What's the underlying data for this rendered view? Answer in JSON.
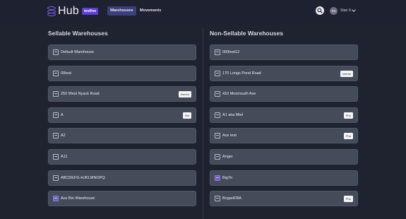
{
  "app": {
    "title": "Hub",
    "badge": "testlive"
  },
  "nav": [
    {
      "label": "Warehouses",
      "active": true
    },
    {
      "label": "Movements",
      "active": false
    }
  ],
  "user": {
    "initials": "SS",
    "name": "Stan S"
  },
  "sellable": {
    "title": "Sellable Warehouses",
    "items": [
      {
        "label": "Default Warehouse",
        "tag": "",
        "icon": "warehouse-icon"
      },
      {
        "label": "00test",
        "tag": "",
        "icon": "warehouse-icon"
      },
      {
        "label": "250 West Nyack Road",
        "tag": "Interim",
        "icon": "warehouse-icon"
      },
      {
        "label": "A",
        "tag": "Bin",
        "icon": "warehouse-icon"
      },
      {
        "label": "A2",
        "tag": "",
        "icon": "warehouse-icon"
      },
      {
        "label": "A11",
        "tag": "",
        "icon": "warehouse-icon"
      },
      {
        "label": "ABCDEFG-HJKLMNOPQ",
        "tag": "",
        "icon": "warehouse-icon"
      },
      {
        "label": "Ace Bin Warehouse",
        "tag": "",
        "icon": "warehouse-alt-icon"
      }
    ]
  },
  "nonsellable": {
    "title": "Non-Sellable Warehouses",
    "items": [
      {
        "label": "000test12",
        "tag": "",
        "icon": "warehouse-icon"
      },
      {
        "label": "170 Longs Pond Road",
        "tag": "Interim",
        "icon": "warehouse-icon"
      },
      {
        "label": "410 Monmouth Ave",
        "tag": "",
        "icon": "warehouse-icon"
      },
      {
        "label": "A1 aka Mtel",
        "tag": "Pho",
        "icon": "warehouse-icon"
      },
      {
        "label": "Ace test",
        "tag": "Pho",
        "icon": "warehouse-icon"
      },
      {
        "label": "Anger",
        "tag": "",
        "icon": "warehouse-icon"
      },
      {
        "label": "BigYo",
        "tag": "",
        "icon": "warehouse-alt-icon"
      },
      {
        "label": "BogartFBA",
        "tag": "Pho",
        "icon": "warehouse-icon"
      }
    ]
  },
  "colors": {
    "background": "#1f2330",
    "card": "#454b59",
    "accent": "#5b3fd6",
    "active_tab": "#3d3f7a"
  }
}
